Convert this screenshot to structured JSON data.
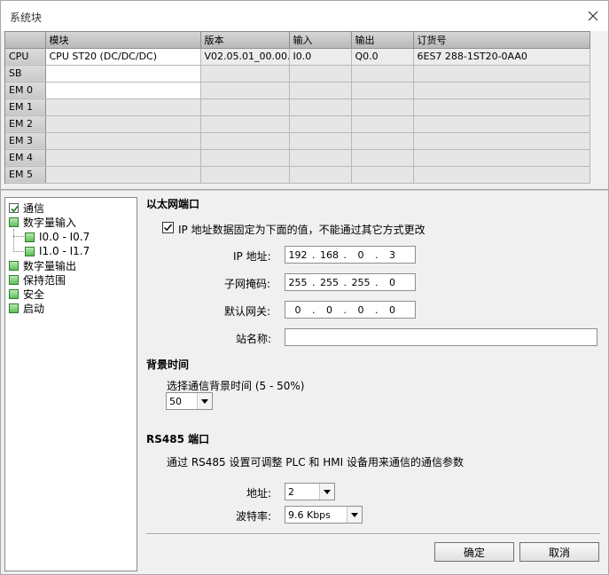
{
  "window": {
    "title": "系统块"
  },
  "table": {
    "columns": [
      "模块",
      "版本",
      "输入",
      "输出",
      "订货号"
    ],
    "rows": [
      {
        "slot": "CPU",
        "module": "CPU ST20 (DC/DC/DC)",
        "version": "V02.05.01_00.00...",
        "input": "I0.0",
        "output": "Q0.0",
        "order": "6ES7 288-1ST20-0AA0"
      },
      {
        "slot": "SB",
        "module": "",
        "version": "",
        "input": "",
        "output": "",
        "order": ""
      },
      {
        "slot": "EM 0",
        "module": "",
        "version": "",
        "input": "",
        "output": "",
        "order": ""
      },
      {
        "slot": "EM 1",
        "module": "",
        "version": "",
        "input": "",
        "output": "",
        "order": ""
      },
      {
        "slot": "EM 2",
        "module": "",
        "version": "",
        "input": "",
        "output": "",
        "order": ""
      },
      {
        "slot": "EM 3",
        "module": "",
        "version": "",
        "input": "",
        "output": "",
        "order": ""
      },
      {
        "slot": "EM 4",
        "module": "",
        "version": "",
        "input": "",
        "output": "",
        "order": ""
      },
      {
        "slot": "EM 5",
        "module": "",
        "version": "",
        "input": "",
        "output": "",
        "order": ""
      }
    ]
  },
  "tree": {
    "items": [
      {
        "label": "通信"
      },
      {
        "label": "数字量输入"
      },
      {
        "label": "I0.0 - I0.7"
      },
      {
        "label": "I1.0 - I1.7"
      },
      {
        "label": "数字量输出"
      },
      {
        "label": "保持范围"
      },
      {
        "label": "安全"
      },
      {
        "label": "启动"
      }
    ]
  },
  "ethernet": {
    "title": "以太网端口",
    "fixed_ip_label": "IP 地址数据固定为下面的值，不能通过其它方式更改",
    "ip_label": "IP 地址:",
    "ip": [
      "192",
      "168",
      "0",
      "3"
    ],
    "mask_label": "子网掩码:",
    "mask": [
      "255",
      "255",
      "255",
      "0"
    ],
    "gateway_label": "默认网关:",
    "gateway": [
      "0",
      "0",
      "0",
      "0"
    ],
    "station_label": "站名称:",
    "station_value": ""
  },
  "background": {
    "title": "背景时间",
    "select_label": "选择通信背景时间 (5 - 50%)",
    "value": "50"
  },
  "rs485": {
    "title": "RS485 端口",
    "description": "通过 RS485 设置可调整 PLC 和 HMI 设备用来通信的通信参数",
    "address_label": "地址:",
    "address_value": "2",
    "baud_label": "波特率:",
    "baud_value": "9.6 Kbps"
  },
  "buttons": {
    "ok": "确定",
    "cancel": "取消"
  }
}
